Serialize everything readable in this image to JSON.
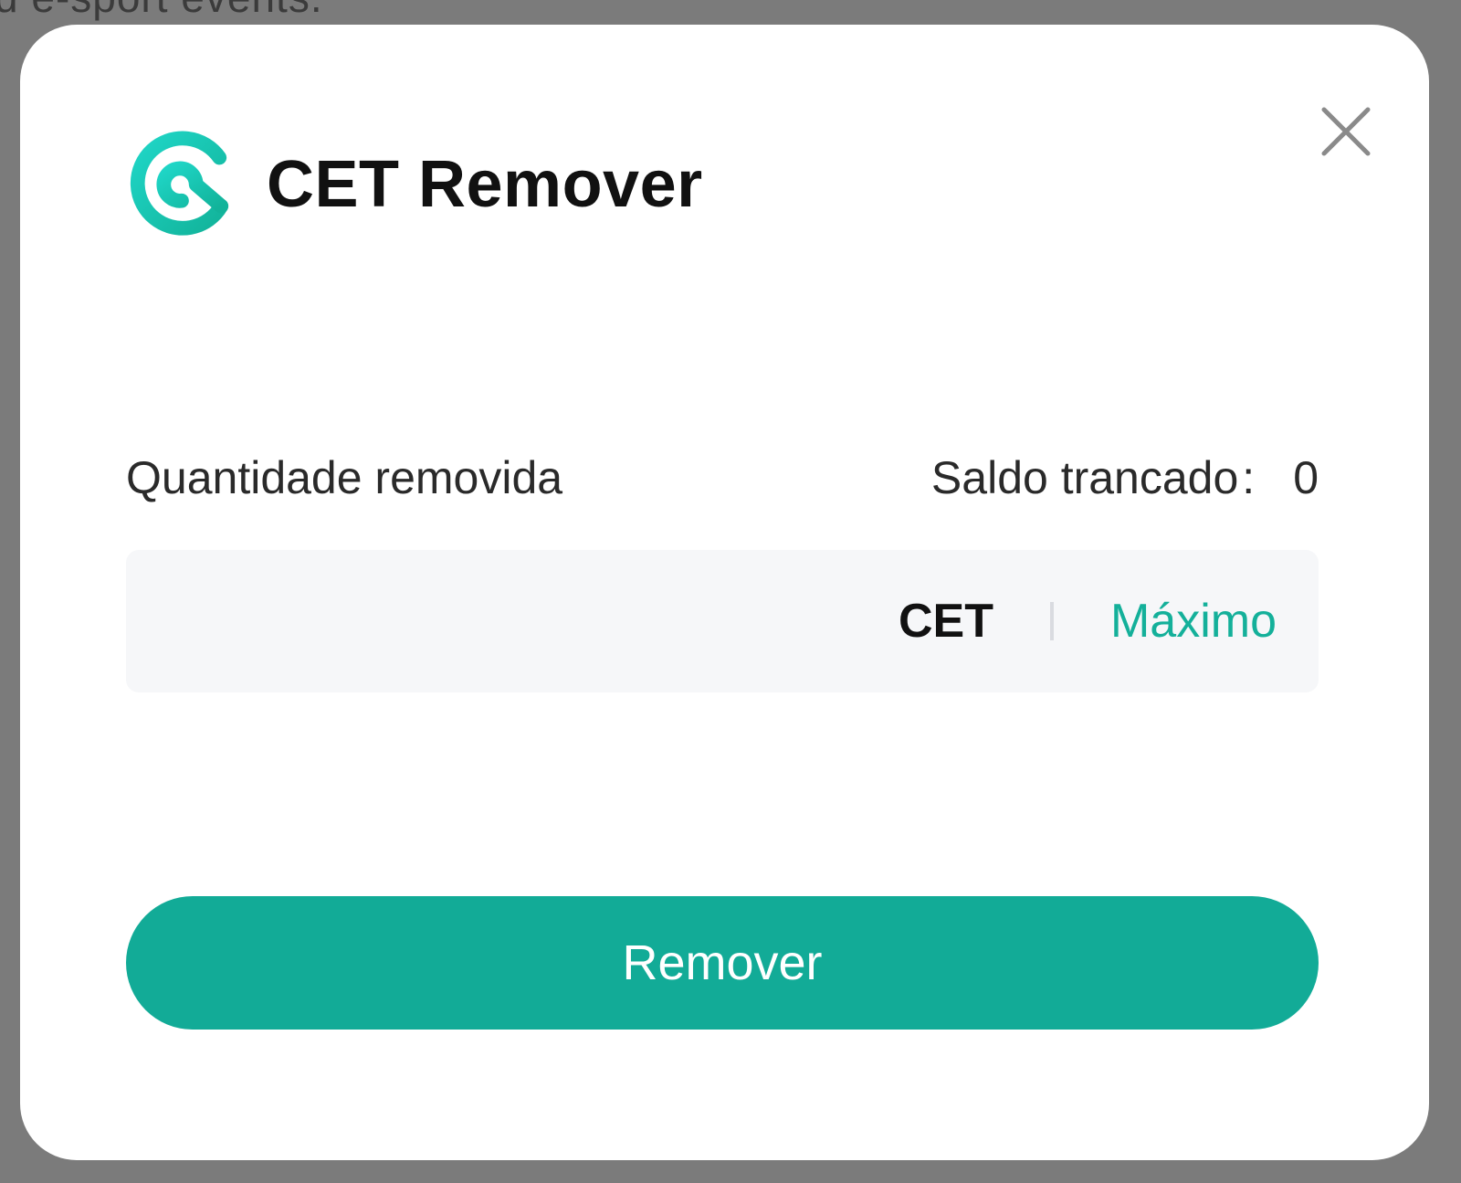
{
  "background": {
    "text": "d e-sport events."
  },
  "modal": {
    "title": "CET Remover",
    "logo_icon": "coinex-logo-icon",
    "close_icon": "close-icon",
    "amount_label": "Quantidade removida",
    "balance_label": "Saldo trancado",
    "balance_separator": ":",
    "balance_value": "0",
    "amount_input": {
      "value": "",
      "placeholder": ""
    },
    "unit": "CET",
    "max_label": "Máximo",
    "submit_label": "Remover"
  },
  "colors": {
    "accent": "#12ab97",
    "max_link": "#14b09a",
    "input_bg": "#f6f7f9",
    "overlay": "#7b7b7b"
  }
}
